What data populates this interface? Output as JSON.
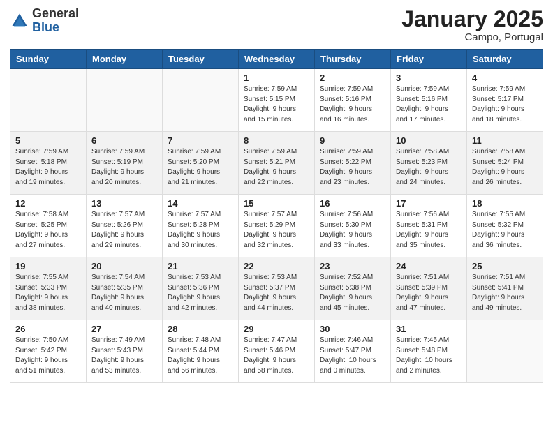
{
  "header": {
    "logo_general": "General",
    "logo_blue": "Blue",
    "month": "January 2025",
    "location": "Campo, Portugal"
  },
  "weekdays": [
    "Sunday",
    "Monday",
    "Tuesday",
    "Wednesday",
    "Thursday",
    "Friday",
    "Saturday"
  ],
  "weeks": [
    [
      {
        "day": "",
        "sunrise": "",
        "sunset": "",
        "daylight": ""
      },
      {
        "day": "",
        "sunrise": "",
        "sunset": "",
        "daylight": ""
      },
      {
        "day": "",
        "sunrise": "",
        "sunset": "",
        "daylight": ""
      },
      {
        "day": "1",
        "sunrise": "Sunrise: 7:59 AM",
        "sunset": "Sunset: 5:15 PM",
        "daylight": "Daylight: 9 hours and 15 minutes."
      },
      {
        "day": "2",
        "sunrise": "Sunrise: 7:59 AM",
        "sunset": "Sunset: 5:16 PM",
        "daylight": "Daylight: 9 hours and 16 minutes."
      },
      {
        "day": "3",
        "sunrise": "Sunrise: 7:59 AM",
        "sunset": "Sunset: 5:16 PM",
        "daylight": "Daylight: 9 hours and 17 minutes."
      },
      {
        "day": "4",
        "sunrise": "Sunrise: 7:59 AM",
        "sunset": "Sunset: 5:17 PM",
        "daylight": "Daylight: 9 hours and 18 minutes."
      }
    ],
    [
      {
        "day": "5",
        "sunrise": "Sunrise: 7:59 AM",
        "sunset": "Sunset: 5:18 PM",
        "daylight": "Daylight: 9 hours and 19 minutes."
      },
      {
        "day": "6",
        "sunrise": "Sunrise: 7:59 AM",
        "sunset": "Sunset: 5:19 PM",
        "daylight": "Daylight: 9 hours and 20 minutes."
      },
      {
        "day": "7",
        "sunrise": "Sunrise: 7:59 AM",
        "sunset": "Sunset: 5:20 PM",
        "daylight": "Daylight: 9 hours and 21 minutes."
      },
      {
        "day": "8",
        "sunrise": "Sunrise: 7:59 AM",
        "sunset": "Sunset: 5:21 PM",
        "daylight": "Daylight: 9 hours and 22 minutes."
      },
      {
        "day": "9",
        "sunrise": "Sunrise: 7:59 AM",
        "sunset": "Sunset: 5:22 PM",
        "daylight": "Daylight: 9 hours and 23 minutes."
      },
      {
        "day": "10",
        "sunrise": "Sunrise: 7:58 AM",
        "sunset": "Sunset: 5:23 PM",
        "daylight": "Daylight: 9 hours and 24 minutes."
      },
      {
        "day": "11",
        "sunrise": "Sunrise: 7:58 AM",
        "sunset": "Sunset: 5:24 PM",
        "daylight": "Daylight: 9 hours and 26 minutes."
      }
    ],
    [
      {
        "day": "12",
        "sunrise": "Sunrise: 7:58 AM",
        "sunset": "Sunset: 5:25 PM",
        "daylight": "Daylight: 9 hours and 27 minutes."
      },
      {
        "day": "13",
        "sunrise": "Sunrise: 7:57 AM",
        "sunset": "Sunset: 5:26 PM",
        "daylight": "Daylight: 9 hours and 29 minutes."
      },
      {
        "day": "14",
        "sunrise": "Sunrise: 7:57 AM",
        "sunset": "Sunset: 5:28 PM",
        "daylight": "Daylight: 9 hours and 30 minutes."
      },
      {
        "day": "15",
        "sunrise": "Sunrise: 7:57 AM",
        "sunset": "Sunset: 5:29 PM",
        "daylight": "Daylight: 9 hours and 32 minutes."
      },
      {
        "day": "16",
        "sunrise": "Sunrise: 7:56 AM",
        "sunset": "Sunset: 5:30 PM",
        "daylight": "Daylight: 9 hours and 33 minutes."
      },
      {
        "day": "17",
        "sunrise": "Sunrise: 7:56 AM",
        "sunset": "Sunset: 5:31 PM",
        "daylight": "Daylight: 9 hours and 35 minutes."
      },
      {
        "day": "18",
        "sunrise": "Sunrise: 7:55 AM",
        "sunset": "Sunset: 5:32 PM",
        "daylight": "Daylight: 9 hours and 36 minutes."
      }
    ],
    [
      {
        "day": "19",
        "sunrise": "Sunrise: 7:55 AM",
        "sunset": "Sunset: 5:33 PM",
        "daylight": "Daylight: 9 hours and 38 minutes."
      },
      {
        "day": "20",
        "sunrise": "Sunrise: 7:54 AM",
        "sunset": "Sunset: 5:35 PM",
        "daylight": "Daylight: 9 hours and 40 minutes."
      },
      {
        "day": "21",
        "sunrise": "Sunrise: 7:53 AM",
        "sunset": "Sunset: 5:36 PM",
        "daylight": "Daylight: 9 hours and 42 minutes."
      },
      {
        "day": "22",
        "sunrise": "Sunrise: 7:53 AM",
        "sunset": "Sunset: 5:37 PM",
        "daylight": "Daylight: 9 hours and 44 minutes."
      },
      {
        "day": "23",
        "sunrise": "Sunrise: 7:52 AM",
        "sunset": "Sunset: 5:38 PM",
        "daylight": "Daylight: 9 hours and 45 minutes."
      },
      {
        "day": "24",
        "sunrise": "Sunrise: 7:51 AM",
        "sunset": "Sunset: 5:39 PM",
        "daylight": "Daylight: 9 hours and 47 minutes."
      },
      {
        "day": "25",
        "sunrise": "Sunrise: 7:51 AM",
        "sunset": "Sunset: 5:41 PM",
        "daylight": "Daylight: 9 hours and 49 minutes."
      }
    ],
    [
      {
        "day": "26",
        "sunrise": "Sunrise: 7:50 AM",
        "sunset": "Sunset: 5:42 PM",
        "daylight": "Daylight: 9 hours and 51 minutes."
      },
      {
        "day": "27",
        "sunrise": "Sunrise: 7:49 AM",
        "sunset": "Sunset: 5:43 PM",
        "daylight": "Daylight: 9 hours and 53 minutes."
      },
      {
        "day": "28",
        "sunrise": "Sunrise: 7:48 AM",
        "sunset": "Sunset: 5:44 PM",
        "daylight": "Daylight: 9 hours and 56 minutes."
      },
      {
        "day": "29",
        "sunrise": "Sunrise: 7:47 AM",
        "sunset": "Sunset: 5:46 PM",
        "daylight": "Daylight: 9 hours and 58 minutes."
      },
      {
        "day": "30",
        "sunrise": "Sunrise: 7:46 AM",
        "sunset": "Sunset: 5:47 PM",
        "daylight": "Daylight: 10 hours and 0 minutes."
      },
      {
        "day": "31",
        "sunrise": "Sunrise: 7:45 AM",
        "sunset": "Sunset: 5:48 PM",
        "daylight": "Daylight: 10 hours and 2 minutes."
      },
      {
        "day": "",
        "sunrise": "",
        "sunset": "",
        "daylight": ""
      }
    ]
  ]
}
